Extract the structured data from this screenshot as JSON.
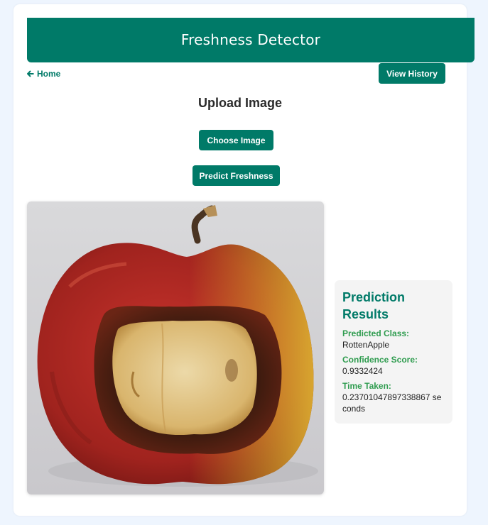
{
  "header": {
    "title": "Freshness Detector"
  },
  "nav": {
    "home_label": "Home",
    "history_label": "View History"
  },
  "upload": {
    "title": "Upload Image",
    "choose_label": "Choose Image",
    "predict_label": "Predict Freshness"
  },
  "results": {
    "title": "Prediction Results",
    "class_label": "Predicted Class:",
    "class_value": "RottenApple",
    "confidence_label": "Confidence Score:",
    "confidence_value": "0.9332424",
    "time_label": "Time Taken:",
    "time_value": "0.23701047897338867 seconds"
  },
  "colors": {
    "accent": "#007a68",
    "label_green": "#2f9c4f",
    "page_bg": "#eef5fe"
  },
  "icons": {
    "home": "arrow-left-icon"
  }
}
